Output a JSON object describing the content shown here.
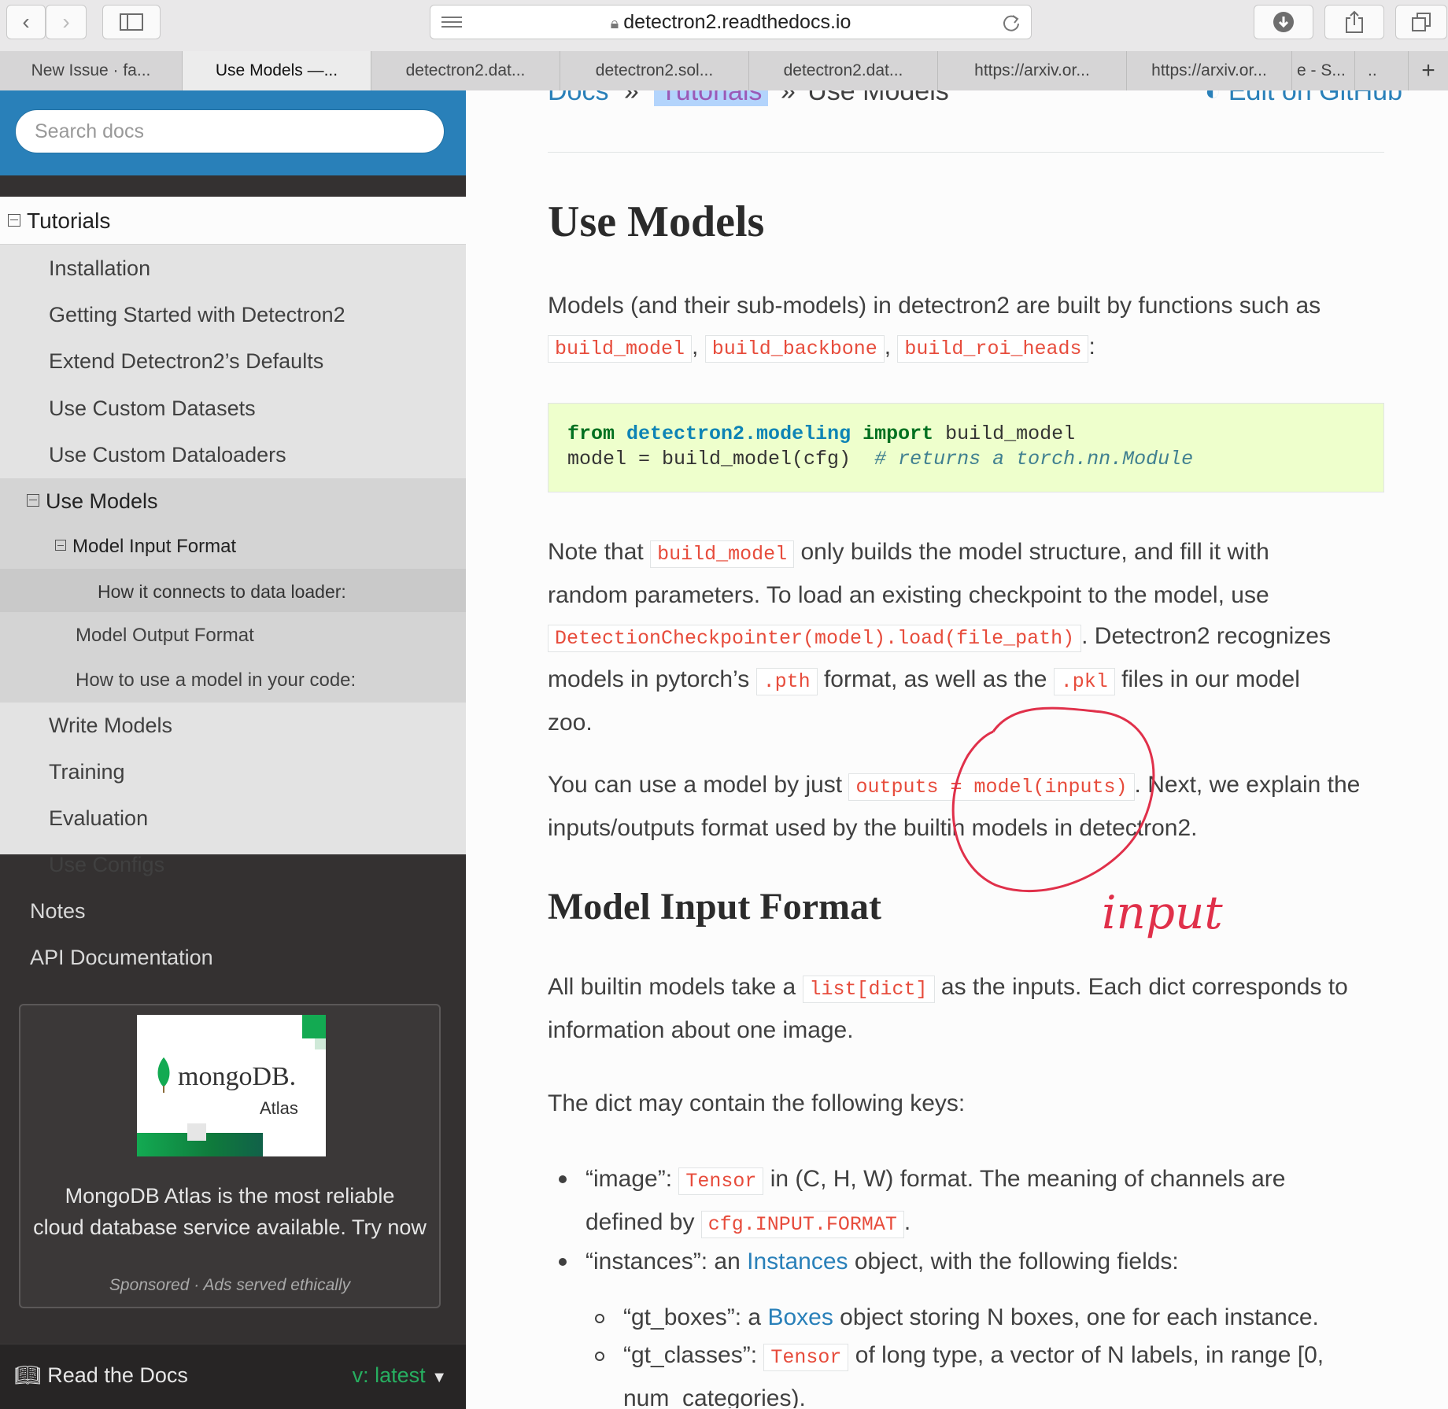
{
  "browser": {
    "url": "detectron2.readthedocs.io",
    "tabs": [
      {
        "label": "New Issue · fa..."
      },
      {
        "label": "Use Models —..."
      },
      {
        "label": "detectron2.dat..."
      },
      {
        "label": "detectron2.sol..."
      },
      {
        "label": "detectron2.dat..."
      },
      {
        "label": "https://arxiv.or..."
      },
      {
        "label": "https://arxiv.or..."
      },
      {
        "label": "e - S..."
      },
      {
        "label": ".."
      }
    ]
  },
  "sidebar": {
    "search_placeholder": "Search docs",
    "section": "Tutorials",
    "items": [
      "Installation",
      "Getting Started with Detectron2",
      "Extend Detectron2’s Defaults",
      "Use Custom Datasets",
      "Use Custom Dataloaders",
      "Use Models",
      "Model Input Format",
      "How it connects to data loader:",
      "Model Output Format",
      "How to use a model in your code:",
      "Write Models",
      "Training",
      "Evaluation",
      "Use Configs",
      "Notes",
      "API Documentation"
    ],
    "ad": {
      "brand": "mongoDB.",
      "product": "Atlas",
      "text_line1": "MongoDB Atlas is the most reliable",
      "text_line2": "cloud database service available. Try now",
      "sponsor": "Sponsored · Ads served ethically"
    },
    "footer": {
      "rtd": "Read the Docs",
      "version": "v: latest"
    }
  },
  "main": {
    "breadcrumb": [
      "Docs",
      "»",
      "Tutorials",
      "»",
      "Use Models"
    ],
    "edit_link": "Edit on GitHub",
    "title": "Use Models",
    "intro": "Models (and their sub-models) in detectron2 are built by functions such as",
    "fn1": "build_model",
    "fn2": "build_backbone",
    "fn3": "build_roi_heads",
    "code": {
      "kw_from": "from",
      "module": "detectron2.modeling",
      "kw_import": "import",
      "name": "build_model",
      "line2": "model = build_model(cfg)",
      "comment": "# returns a torch.nn.Module"
    },
    "note": {
      "t1": "Note that",
      "c1": "build_model",
      "t2": "only builds the model structure, and fill it with",
      "t3": "random parameters. To load an existing checkpoint to the model, use",
      "c2": "DetectionCheckpointer(model).load(file_path)",
      "t4": ". Detectron2 recognizes",
      "t5": "models in pytorch’s",
      "c3": ".pth",
      "t6": "format, as well as the",
      "c4": ".pkl",
      "t7": "files in our model",
      "t8": "zoo."
    },
    "usage": {
      "t1": "You can use a model by just",
      "c1": "outputs = model(inputs)",
      "t2": ". Next, we explain the",
      "t3": "inputs/outputs format used by the builtin models in detectron2."
    },
    "h2": "Model Input Format",
    "input": {
      "t1": "All builtin models take a",
      "c1": "list[dict]",
      "t2": "as the inputs. Each dict corresponds to",
      "t3": "information about one image."
    },
    "keys_intro": "The dict may contain the following keys:",
    "bullets": {
      "image_a": "“image”:",
      "image_c": "Tensor",
      "image_b": "in (C, H, W) format. The meaning of channels are",
      "image_d": "defined by",
      "image_c2": "cfg.INPUT.FORMAT",
      "instances_a": "“instances”: an",
      "instances_link": "Instances",
      "instances_b": "object, with the following fields:",
      "gtb_a": "“gt_boxes”: a",
      "gtb_link": "Boxes",
      "gtb_b": "object storing N boxes, one for each instance.",
      "gtc_a": "“gt_classes”:",
      "gtc_c": "Tensor",
      "gtc_b": "of long type, a vector of N labels, in range [0,",
      "gtc_d": "num_categories)."
    },
    "annotation": "input"
  },
  "colors": {
    "accent": "#2980b9",
    "sidebar_dark": "#343131",
    "code_red": "#e74c3c",
    "code_bg": "#eeffcc",
    "annotation": "#e0304a",
    "version": "#27ae60"
  }
}
